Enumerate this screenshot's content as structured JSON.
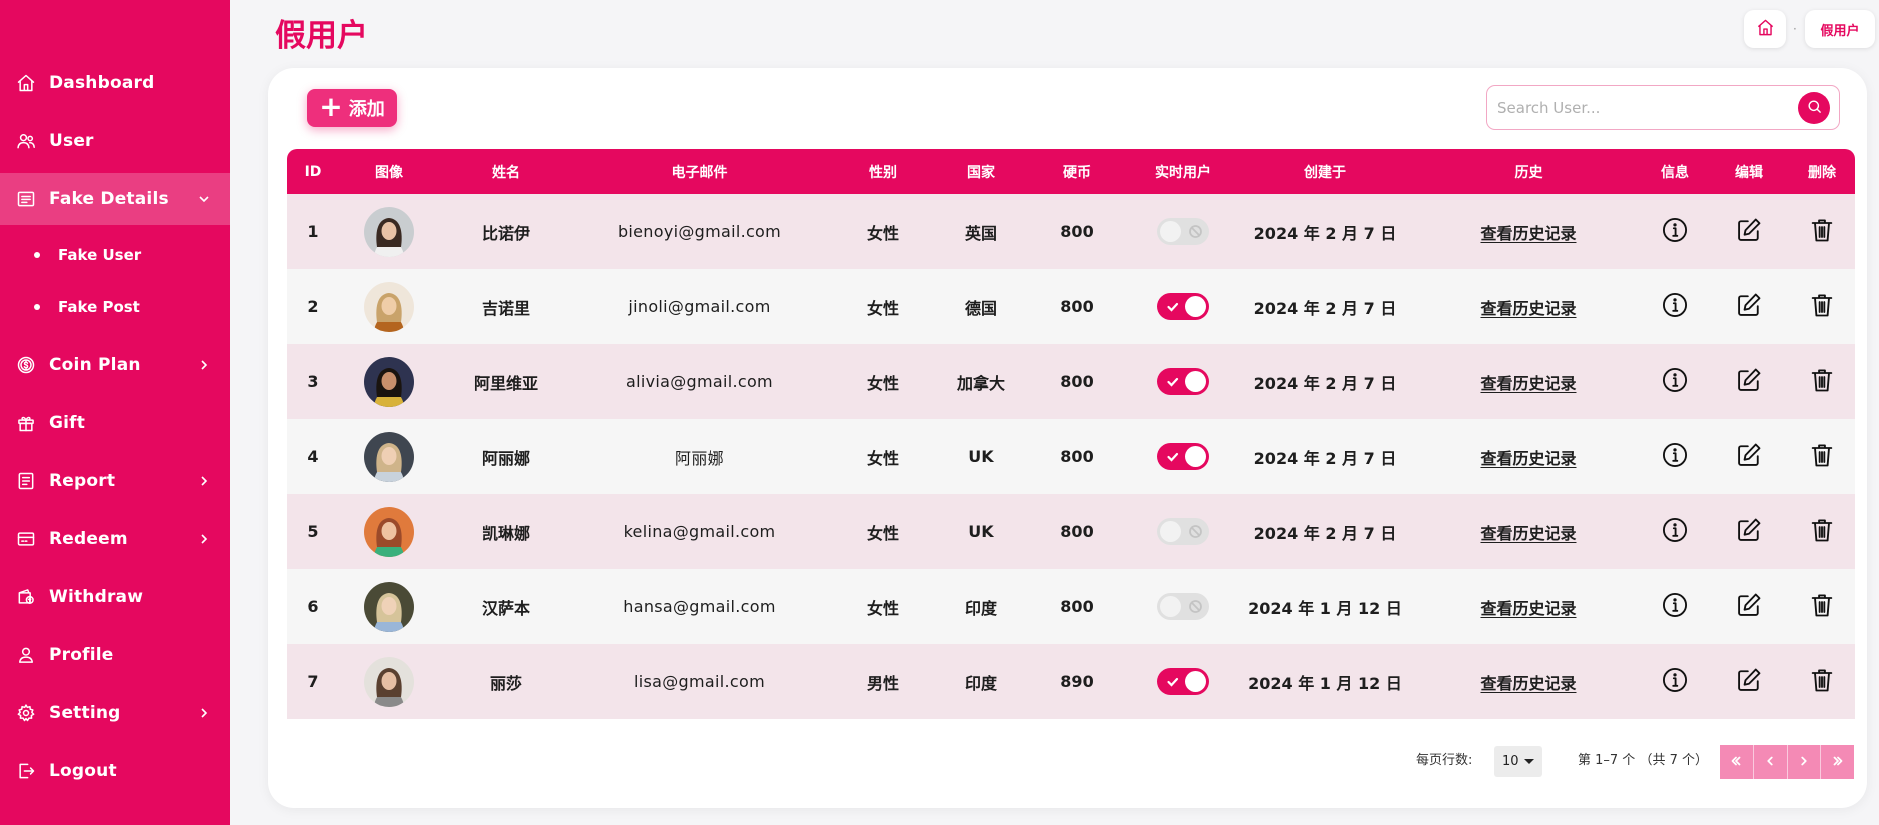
{
  "sidebar": {
    "items": [
      {
        "label": "Dashboard",
        "icon": "home-icon",
        "chevron": false
      },
      {
        "label": "User",
        "icon": "users-icon",
        "chevron": false
      },
      {
        "label": "Fake Details",
        "icon": "list-icon",
        "chevron": true,
        "active": true,
        "expanded": true
      },
      {
        "label": "Coin Plan",
        "icon": "coin-icon",
        "chevron": true
      },
      {
        "label": "Gift",
        "icon": "gift-icon",
        "chevron": false
      },
      {
        "label": "Report",
        "icon": "report-icon",
        "chevron": true
      },
      {
        "label": "Redeem",
        "icon": "ticket-icon",
        "chevron": true
      },
      {
        "label": "Withdraw",
        "icon": "wallet-icon",
        "chevron": false
      },
      {
        "label": "Profile",
        "icon": "person-icon",
        "chevron": false
      },
      {
        "label": "Setting",
        "icon": "gear-icon",
        "chevron": true
      },
      {
        "label": "Logout",
        "icon": "logout-icon",
        "chevron": false
      }
    ],
    "subitems": [
      {
        "label": "Fake User"
      },
      {
        "label": "Fake Post"
      }
    ]
  },
  "header": {
    "title": "假用户",
    "breadcrumb_current": "假用户",
    "breadcrumb_separator": "·"
  },
  "toolbar": {
    "add_label": "添加",
    "search_placeholder": "Search User..."
  },
  "table": {
    "headers": [
      "ID",
      "图像",
      "姓名",
      "电子邮件",
      "性别",
      "国家",
      "硬币",
      "实时用户",
      "创建于",
      "历史",
      "信息",
      "编辑",
      "删除"
    ],
    "history_link_text": "查看历史记录",
    "rows": [
      {
        "id": "1",
        "name": "比诺伊",
        "email": "bienoyi@gmail.com",
        "gender": "女性",
        "country": "英国",
        "coins": "800",
        "live": false,
        "created": "2024 年 2 月 7 日",
        "avatar": {
          "bg": "#c9cdd0",
          "hair": "#3a2a22",
          "skin": "#e8c2a6",
          "cloth": "#f0f0f0"
        }
      },
      {
        "id": "2",
        "name": "吉诺里",
        "email": "jinoli@gmail.com",
        "gender": "女性",
        "country": "德国",
        "coins": "800",
        "live": true,
        "created": "2024 年 2 月 7 日",
        "avatar": {
          "bg": "#efe6da",
          "hair": "#c9a36a",
          "skin": "#efcda8",
          "cloth": "#b4651f"
        }
      },
      {
        "id": "3",
        "name": "阿里维亚",
        "email": "alivia@gmail.com",
        "gender": "女性",
        "country": "加拿大",
        "coins": "800",
        "live": true,
        "created": "2024 年 2 月 7 日",
        "avatar": {
          "bg": "#2e3350",
          "hair": "#1a140f",
          "skin": "#c9906c",
          "cloth": "#d8b23a"
        }
      },
      {
        "id": "4",
        "name": "阿丽娜",
        "email": "阿丽娜",
        "gender": "女性",
        "country": "UK",
        "coins": "800",
        "live": true,
        "created": "2024 年 2 月 7 日",
        "avatar": {
          "bg": "#3f4650",
          "hair": "#cfb48a",
          "skin": "#efcfb4",
          "cloth": "#c8d2dc"
        }
      },
      {
        "id": "5",
        "name": "凯琳娜",
        "email": "kelina@gmail.com",
        "gender": "女性",
        "country": "UK",
        "coins": "800",
        "live": false,
        "created": "2024 年 2 月 7 日",
        "avatar": {
          "bg": "#e07a3c",
          "hair": "#9b4a2a",
          "skin": "#efc2a0",
          "cloth": "#3ab07c"
        }
      },
      {
        "id": "6",
        "name": "汉萨本",
        "email": "hansa@gmail.com",
        "gender": "女性",
        "country": "印度",
        "coins": "800",
        "live": false,
        "created": "2024 年 1 月 12 日",
        "avatar": {
          "bg": "#4a4a36",
          "hair": "#d6c49a",
          "skin": "#efd2b8",
          "cloth": "#9ab6d8"
        }
      },
      {
        "id": "7",
        "name": "丽莎",
        "email": "lisa@gmail.com",
        "gender": "男性",
        "country": "印度",
        "coins": "890",
        "live": true,
        "created": "2024 年 1 月 12 日",
        "avatar": {
          "bg": "#e4e1dc",
          "hair": "#5a4030",
          "skin": "#e6bfa4",
          "cloth": "#8a8a8a"
        }
      }
    ]
  },
  "pagination": {
    "rows_per_page_label": "每页行数:",
    "rows_per_page_value": "10",
    "range_text": "第 1–7 个 （共 7 个）"
  },
  "colors": {
    "brand": "#e5085f",
    "row_odd": "#f3e4ea",
    "row_even": "#f6f6f6",
    "pagination_bg": "#f48ab5"
  }
}
